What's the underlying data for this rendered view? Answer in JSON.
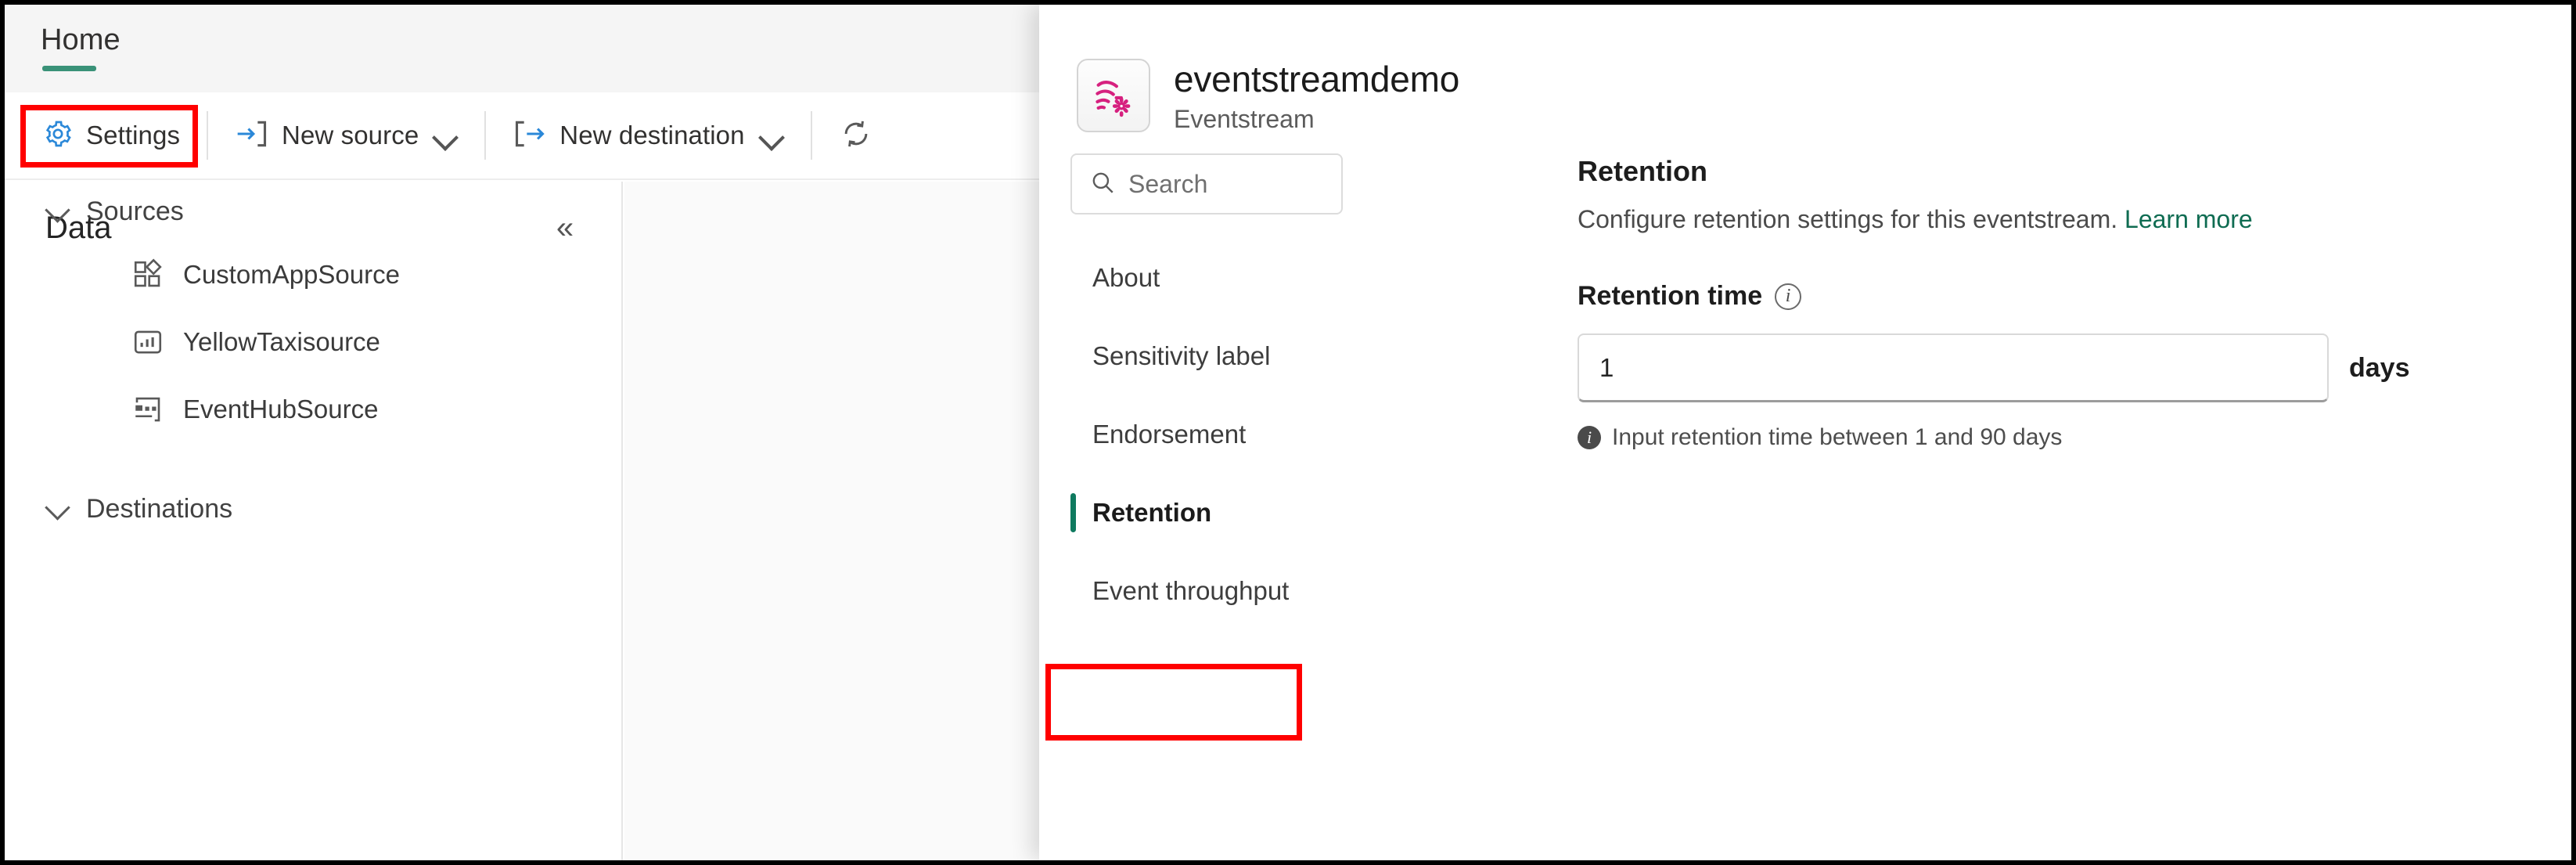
{
  "ribbon": {
    "tabs": [
      {
        "label": "Home",
        "selected": true
      }
    ],
    "commands": [
      {
        "label": "Settings",
        "icon": "gear-icon",
        "has_chevron": false
      },
      {
        "label": "New source",
        "icon": "arrow-into-bracket-icon",
        "has_chevron": true
      },
      {
        "label": "New destination",
        "icon": "bracket-out-arrow-icon",
        "has_chevron": true
      },
      {
        "label": "",
        "icon": "refresh-icon",
        "has_chevron": false
      }
    ],
    "accent_color": "#3a9278"
  },
  "highlight_color": "#ff0000",
  "data_pane": {
    "title": "Data",
    "collapse_icon": "«",
    "groups": [
      {
        "label": "Sources",
        "expanded": true,
        "items": [
          {
            "label": "CustomAppSource",
            "icon": "custom-app-icon"
          },
          {
            "label": "YellowTaxisource",
            "icon": "bar-chart-icon"
          },
          {
            "label": "EventHubSource",
            "icon": "event-hub-icon"
          }
        ]
      },
      {
        "label": "Destinations",
        "expanded": true,
        "items": []
      }
    ]
  },
  "panel": {
    "title": "eventstreamdemo",
    "subtitle": "Eventstream",
    "icon": "eventstream-icon",
    "search": {
      "placeholder": "Search",
      "value": "",
      "icon": "search-icon"
    },
    "nav_items": [
      {
        "label": "About",
        "selected": false
      },
      {
        "label": "Sensitivity label",
        "selected": false
      },
      {
        "label": "Endorsement",
        "selected": false
      },
      {
        "label": "Retention",
        "selected": true
      },
      {
        "label": "Event throughput",
        "selected": false
      }
    ],
    "selected_accent": "#0f7a5f",
    "content": {
      "title": "Retention",
      "description": "Configure retention settings for this eventstream.",
      "learn_more": "Learn more",
      "learn_more_color": "#0f6c52",
      "field_label": "Retention time",
      "field_info_icon": "info-icon",
      "input_value": "1",
      "unit_label": "days",
      "hint_icon": "info-filled-icon",
      "hint_text": "Input retention time between 1 and 90 days"
    }
  }
}
